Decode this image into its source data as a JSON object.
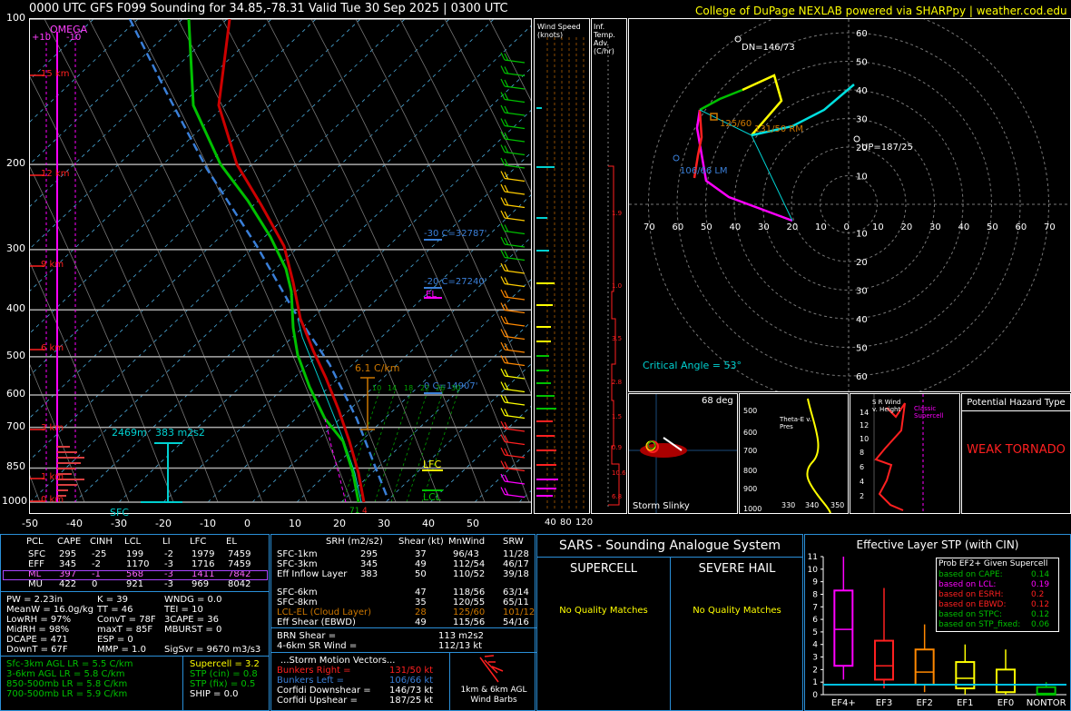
{
  "header": {
    "title": "0000 UTC GFS F099 Sounding for 34.85,-78.31 Valid  Tue 30 Sep 2025 | 0300 UTC",
    "credit": "College of DuPage NEXLAB powered via SHARPpy | weather.cod.edu"
  },
  "colors": {
    "temp": "#ff2020",
    "dew": "#00c000",
    "wetbulb": "#00d0d0",
    "parcel": "#3a7fd8",
    "yellow": "#ffff00",
    "magenta": "#ff00ff",
    "cyan": "#00e0e0",
    "orange": "#ff8800"
  },
  "skewt": {
    "pressure_labels": [
      "100",
      "200",
      "300",
      "400",
      "500",
      "600",
      "700",
      "850",
      "1000"
    ],
    "pressure_values": [
      100,
      200,
      300,
      400,
      500,
      600,
      700,
      850,
      1000
    ],
    "temp_ticks": [
      "-50",
      "-40",
      "-30",
      "-20",
      "-10",
      "0",
      "10",
      "20",
      "30",
      "40",
      "50"
    ],
    "height_labels": [
      "15 km",
      "12 km",
      "9 km",
      "6 km",
      "3 km",
      "1 km",
      "0 km"
    ],
    "omega_label": "OMEGA",
    "omega_ticks": [
      "+10",
      "-10"
    ],
    "sfc_label": "SFC",
    "lfc_label": "LFC",
    "lcl_label": "LCL",
    "el_label": "EL",
    "srh_label": "383 m2s2",
    "height_2469": "2469m",
    "lapse_label": "6.1 C/km",
    "wbz_labels": [
      "-30 C=32787'",
      "-20 C=27240'",
      "0 C=14907'"
    ],
    "mixing_ratios": [
      "10",
      "14",
      "18",
      "22",
      "26",
      "30"
    ],
    "sfc_temps": [
      "71",
      "4"
    ]
  },
  "wind_speed_panel": {
    "title": "Wind Speed (knots)",
    "ticks": [
      "40",
      "80",
      "120"
    ]
  },
  "inf_temp_panel": {
    "title": "Inf. Temp. Adv. (C/hr)",
    "values": [
      "1.9",
      "1.0",
      "3.5",
      "2.8",
      "1.5",
      "0.9",
      "10.6",
      "6.8"
    ]
  },
  "hodograph": {
    "rings": [
      "10",
      "20",
      "30",
      "40",
      "50",
      "60"
    ],
    "x_labels": [
      "70",
      "60",
      "50",
      "40",
      "30",
      "20",
      "10",
      "0",
      "10",
      "20",
      "30",
      "40",
      "50",
      "60",
      "70"
    ],
    "dn": "DN=146/73",
    "up": "UP=187/25",
    "rm": "131/50 RM",
    "lm": "106/66 LM",
    "mean": "125/60",
    "critical_angle": "Critical Angle = 53°"
  },
  "storm_slinky": {
    "label": "Storm Slinky",
    "deg": "68 deg"
  },
  "theta_panel": {
    "title": "Theta-E v. Pres",
    "p_labels": [
      "500",
      "600",
      "700",
      "800",
      "900",
      "1000"
    ],
    "t_labels": [
      "330",
      "340",
      "350"
    ]
  },
  "srwind_panel": {
    "title": "S R Wind v. Height",
    "classic": "Classic Supercell",
    "h_labels": [
      "14",
      "12",
      "10",
      "8",
      "6",
      "4",
      "2"
    ]
  },
  "hazard": {
    "title": "Potential Hazard Type",
    "value": "WEAK TORNADO"
  },
  "parcel_table": {
    "headers": [
      "PCL",
      "CAPE",
      "CINH",
      "LCL",
      "LI",
      "LFC",
      "EL"
    ],
    "rows": [
      [
        "SFC",
        "295",
        "-25",
        "199",
        "-2",
        "1979",
        "7459"
      ],
      [
        "EFF",
        "345",
        "-2",
        "1170",
        "-3",
        "1716",
        "7459"
      ],
      [
        "ML",
        "397",
        "-1",
        "568",
        "-3",
        "1411",
        "7842"
      ],
      [
        "MU",
        "422",
        "0",
        "921",
        "-3",
        "969",
        "8042"
      ]
    ]
  },
  "indices": {
    "col1": [
      "PW = 2.23in",
      "MeanW = 16.0g/kg",
      "LowRH = 97%",
      "MidRH = 98%",
      "DCAPE = 471",
      "DownT = 67F"
    ],
    "col2": [
      "K = 39",
      "TT = 46",
      "ConvT = 78F",
      "maxT = 85F",
      "ESP = 0",
      "MMP = 1.0"
    ],
    "col3": [
      "WNDG = 0.0",
      "TEI = 10",
      "3CAPE = 36",
      "MBURST = 0",
      "",
      "SigSvr = 9670 m3/s3"
    ],
    "lapse": [
      "Sfc-3km AGL LR = 5.5 C/km",
      "3-6km AGL LR = 5.8 C/km",
      "850-500mb LR = 5.8 C/km",
      "700-500mb LR = 5.9 C/km"
    ],
    "params": [
      "Supercell = 3.2",
      "STP (cin) = 0.8",
      "STP (fix) = 0.5",
      "SHIP = 0.0"
    ]
  },
  "kinematics": {
    "headers": [
      "SRH (m2/s2)",
      "Shear (kt)",
      "MnWind",
      "SRW"
    ],
    "rows": [
      [
        "SFC-1km",
        "295",
        "37",
        "96/43",
        "11/28"
      ],
      [
        "SFC-3km",
        "345",
        "49",
        "112/54",
        "46/17"
      ],
      [
        "Eff Inflow Layer",
        "383",
        "50",
        "110/52",
        "39/18"
      ],
      [
        "",
        "",
        "",
        "",
        ""
      ],
      [
        "SFC-6km",
        "47",
        "118/56",
        "63/14",
        ""
      ],
      [
        "SFC-8km",
        "35",
        "120/55",
        "65/11",
        ""
      ],
      [
        "LCL-EL (Cloud Layer)",
        "28",
        "125/60",
        "101/12",
        ""
      ],
      [
        "Eff Shear (EBWD)",
        "49",
        "115/56",
        "54/16",
        ""
      ]
    ],
    "brn": [
      "BRN Shear =",
      "113 m2s2"
    ],
    "srwind46": [
      "4-6km SR Wind =",
      "112/13 kt"
    ],
    "storm_title": "...Storm Motion Vectors...",
    "storm": [
      [
        "Bunkers Right =",
        "131/50 kt"
      ],
      [
        "Bunkers Left =",
        "106/66 kt"
      ],
      [
        "Corfidi Downshear =",
        "146/73 kt"
      ],
      [
        "Corfidi Upshear =",
        "187/25 kt"
      ]
    ],
    "barb_label": "1km & 6km AGL Wind Barbs"
  },
  "sars": {
    "title": "SARS - Sounding Analogue System",
    "supercell": "SUPERCELL",
    "hail": "SEVERE HAIL",
    "sc_match": "No Quality Matches",
    "hail_match": "No Quality Matches"
  },
  "stp": {
    "title": "Effective Layer STP (with CIN)",
    "y_ticks": [
      "11",
      "10",
      "9",
      "8",
      "7",
      "6",
      "5",
      "4",
      "3",
      "2",
      "1",
      "0"
    ],
    "categories": [
      "EF4+",
      "EF3",
      "EF2",
      "EF1",
      "EF0",
      "NONTOR"
    ],
    "legend_title": "Prob EF2+ Given Supercell",
    "legend": [
      [
        "based on CAPE:",
        "0.14"
      ],
      [
        "based on LCL:",
        "0.19"
      ],
      [
        "based on ESRH:",
        "0.2"
      ],
      [
        "based on EBWD:",
        "0.12"
      ],
      [
        "based on STPC:",
        "0.12"
      ],
      [
        "based on STP_fixed:",
        "0.06"
      ]
    ]
  },
  "chart_data": {
    "type": "box",
    "title": "Effective Layer STP (with CIN)",
    "categories": [
      "EF4+",
      "EF3",
      "EF2",
      "EF1",
      "EF0",
      "NONTOR"
    ],
    "whisker_low": [
      1.2,
      0.5,
      0.2,
      0.0,
      0.0,
      0.0
    ],
    "q1": [
      2.3,
      1.2,
      0.8,
      0.5,
      0.2,
      0.0
    ],
    "median": [
      5.2,
      2.3,
      1.8,
      1.3,
      0.8,
      0.1
    ],
    "q3": [
      8.3,
      4.3,
      3.6,
      2.6,
      2.0,
      0.6
    ],
    "whisker_high": [
      11.0,
      8.5,
      5.6,
      4.0,
      3.6,
      1.0
    ],
    "ylim": [
      0,
      11
    ],
    "current_value": 0.8
  }
}
